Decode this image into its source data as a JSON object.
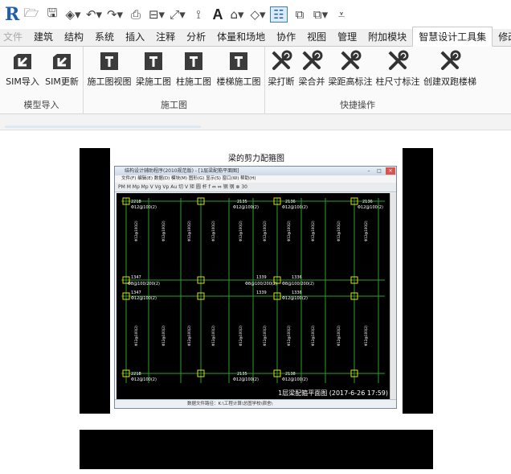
{
  "app": {
    "logo": "R",
    "quick_access": [
      {
        "name": "open-icon",
        "glyph": "🗁"
      },
      {
        "name": "save-icon",
        "glyph": "🖫"
      },
      {
        "name": "sync-icon",
        "glyph": "◈▾"
      },
      {
        "name": "undo-icon",
        "glyph": "↶▾"
      },
      {
        "name": "redo-icon",
        "glyph": "↷▾"
      },
      {
        "name": "print-icon",
        "glyph": "⎙"
      },
      {
        "name": "measure-icon",
        "glyph": "⊟▾"
      },
      {
        "name": "dimension-icon",
        "glyph": "⤢▾"
      },
      {
        "name": "tag-icon",
        "glyph": "⟟"
      },
      {
        "name": "text-icon",
        "glyph": "A"
      },
      {
        "name": "view3d-icon",
        "glyph": "⌂▾"
      },
      {
        "name": "section-icon",
        "glyph": "◇▾"
      },
      {
        "name": "thin-lines-icon",
        "glyph": "☷"
      },
      {
        "name": "close-windows-icon",
        "glyph": "⧉"
      },
      {
        "name": "switch-windows-icon",
        "glyph": "⧉▾"
      },
      {
        "name": "customize-icon",
        "glyph": "⩡"
      }
    ]
  },
  "tabs": [
    {
      "label": "文件",
      "kind": "file"
    },
    {
      "label": "建筑"
    },
    {
      "label": "结构"
    },
    {
      "label": "系统"
    },
    {
      "label": "插入"
    },
    {
      "label": "注释"
    },
    {
      "label": "分析"
    },
    {
      "label": "体量和场地"
    },
    {
      "label": "协作"
    },
    {
      "label": "视图"
    },
    {
      "label": "管理"
    },
    {
      "label": "附加模块"
    },
    {
      "label": "智慧设计工具集",
      "active": true
    },
    {
      "label": "修改"
    }
  ],
  "ribbon": {
    "panels": [
      {
        "title": "模型导入",
        "buttons": [
          {
            "label": "SIM导入",
            "icon": "import-icon"
          },
          {
            "label": "SIM更新",
            "icon": "update-icon"
          }
        ]
      },
      {
        "title": "施工图",
        "buttons": [
          {
            "label": "施工图视图",
            "icon": "drawing-view-icon"
          },
          {
            "label": "梁施工图",
            "icon": "beam-drawing-icon"
          },
          {
            "label": "柱施工图",
            "icon": "column-drawing-icon"
          },
          {
            "label": "楼梯施工图",
            "icon": "stair-drawing-icon"
          }
        ]
      },
      {
        "title": "快捷操作",
        "buttons": [
          {
            "label": "梁打断",
            "icon": "beam-break-icon"
          },
          {
            "label": "梁合并",
            "icon": "beam-merge-icon"
          },
          {
            "label": "梁距高标注",
            "icon": "beam-height-tag-icon"
          },
          {
            "label": "柱尺寸标注",
            "icon": "column-dim-tag-icon"
          },
          {
            "label": "创建双跑楼梯",
            "icon": "double-stair-icon"
          }
        ]
      }
    ]
  },
  "figure": {
    "caption": "梁的剪力配箍图",
    "window_title": "结构设计辅助程序(2010规范版) - [1层梁配筋平面图]",
    "menu": "文件(F)  编辑(E)  数据(D)  模块(M)  图形(G)  显示(S)  窗口(W)  帮助(H)",
    "toolbar_text": "PM M Mp Mp V Vg Vp Au 切 V 矩 圆 杆 f ⇔ ⇔ 钢 钢 ⊗ 30",
    "plan_title": "1层梁配箍平面图 (2017-6-26 17:59)",
    "status_text": "数据文件路径：K:\\工程计算\\总图学校\\宿舍\\",
    "labels": {
      "top_values": [
        "2218",
        "2135",
        "2136",
        "2136"
      ],
      "bottom_values": [
        "2135",
        "2138"
      ],
      "rebar_top": "Φ12@100(2)",
      "row_values": [
        "1347",
        "1339",
        "1336"
      ],
      "row_rebar": "Φ8@100/200(2)",
      "bottom_left": "2218"
    }
  }
}
